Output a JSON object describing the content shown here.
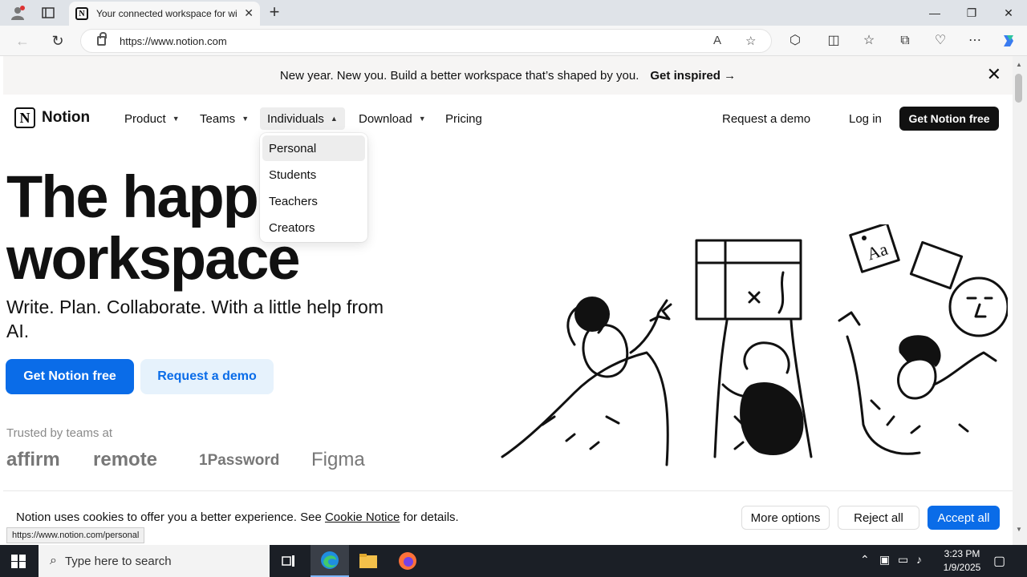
{
  "browser": {
    "tab_title": "Your connected workspace for wiki, docs & projects",
    "url": "https://www.notion.com",
    "new_tab_glyph": "+",
    "minimize_glyph": "—",
    "restore_glyph": "❐",
    "close_glyph": "✕",
    "status_url": "https://www.notion.com/personal"
  },
  "banner": {
    "text": "New year. New you. Build a better workspace that’s shaped by you.",
    "link": "Get inspired →",
    "close_glyph": "✕"
  },
  "nav": {
    "brand": "Notion",
    "logo_letter": "N",
    "items": [
      {
        "label": "Product"
      },
      {
        "label": "Teams"
      },
      {
        "label": "Individuals"
      },
      {
        "label": "Download"
      },
      {
        "label": "Pricing"
      }
    ],
    "chevron_down": "⌄",
    "chevron_up": "⌃",
    "request_demo": "Request a demo",
    "login": "Log in",
    "cta": "Get Notion free"
  },
  "dropdown": {
    "items": [
      "Personal",
      "Students",
      "Teachers",
      "Creators"
    ]
  },
  "hero": {
    "title_line1": "The happiest",
    "title_line2": "workspace",
    "subtitle": "Write. Plan. Collaborate. With a little help from AI.",
    "primary_cta": "Get Notion free",
    "secondary_cta": "Request a demo",
    "trusted_label": "Trusted by teams at",
    "brands": [
      "affirm",
      "remote",
      "1Password",
      "Figma"
    ]
  },
  "cookie": {
    "text_before": "Notion uses cookies to offer you a better experience. See ",
    "link": "Cookie Notice",
    "text_after": " for details.",
    "more_options": "More options",
    "reject": "Reject all",
    "accept": "Accept all"
  },
  "taskbar": {
    "search_placeholder": "Type here to search",
    "time": "3:23 PM",
    "date": "1/9/2025"
  },
  "colors": {
    "accent_blue": "#0a6ce8",
    "light_blue": "#e6f2fc",
    "dark": "#111111"
  }
}
